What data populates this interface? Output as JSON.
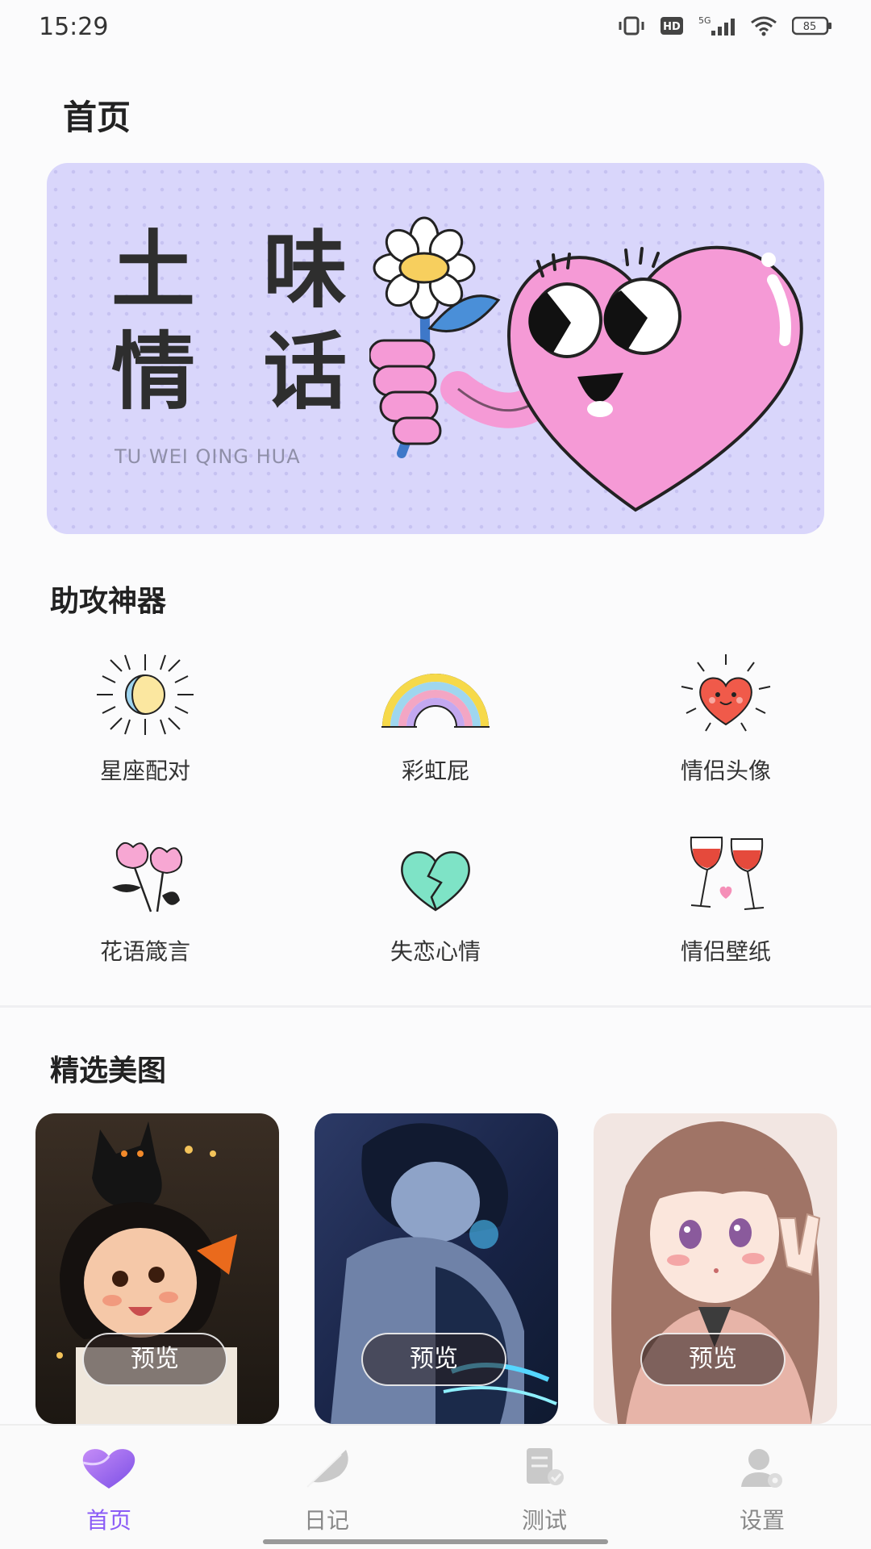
{
  "status_bar": {
    "time": "15:29",
    "battery": "85",
    "network": "5G",
    "hd": "HD"
  },
  "page": {
    "title": "首页"
  },
  "banner": {
    "title_line1": "土 味",
    "title_line2": "情 话",
    "subtitle": "TU WEI QING HUA"
  },
  "tools_section": {
    "title": "助攻神器",
    "items": [
      {
        "label": "星座配对",
        "icon": "sun-moon-icon"
      },
      {
        "label": "彩虹屁",
        "icon": "rainbow-icon"
      },
      {
        "label": "情侣头像",
        "icon": "smiling-heart-icon"
      },
      {
        "label": "花语箴言",
        "icon": "flowers-icon"
      },
      {
        "label": "失恋心情",
        "icon": "broken-heart-icon"
      },
      {
        "label": "情侣壁纸",
        "icon": "wine-glasses-icon"
      }
    ]
  },
  "gallery_section": {
    "title": "精选美图",
    "items": [
      {
        "button": "预览",
        "theme": "girl-with-black-cat"
      },
      {
        "button": "预览",
        "theme": "dark-blue-anime-boy"
      },
      {
        "button": "预览",
        "theme": "brown-hair-anime-girl"
      }
    ]
  },
  "tabbar": {
    "items": [
      {
        "label": "首页",
        "icon": "heart-icon",
        "active": true
      },
      {
        "label": "日记",
        "icon": "feather-icon",
        "active": false
      },
      {
        "label": "测试",
        "icon": "test-icon",
        "active": false
      },
      {
        "label": "设置",
        "icon": "user-settings-icon",
        "active": false
      }
    ]
  },
  "colors": {
    "accent": "#8b5cf6",
    "banner_bg": "#d9d6fb",
    "heart_pink": "#f59ad6"
  }
}
